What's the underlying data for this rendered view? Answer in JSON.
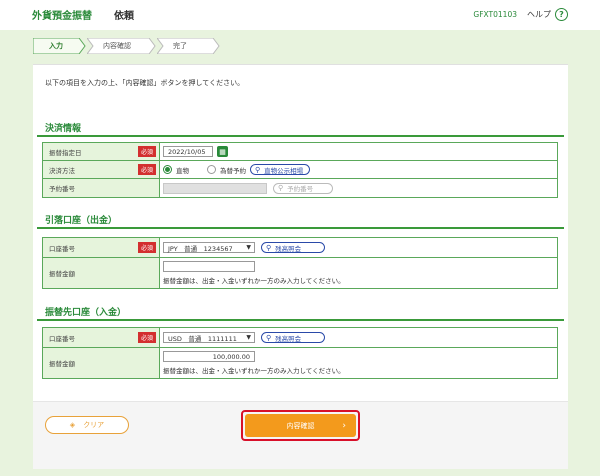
{
  "header": {
    "title": "外貨預金振替",
    "subtitle": "依頼",
    "code": "GFXT01103",
    "help_label": "ヘルプ",
    "help_icon": "?"
  },
  "steps": [
    "入力",
    "内容確認",
    "完了"
  ],
  "intro": "以下の項目を入力の上、「内容確認」ボタンを押してください。",
  "required_label": "必須",
  "settlement": {
    "title": "決済情報",
    "transfer_date_label": "振替指定日",
    "transfer_date_value": "2022/10/05",
    "method_label": "決済方法",
    "method_options": [
      "直物",
      "為替予約"
    ],
    "rate_button": "直物公示相場",
    "reservation_label": "予約番号",
    "reservation_button": "予約番号"
  },
  "withdrawal": {
    "title": "引落口座（出金）",
    "account_label": "口座番号",
    "account_value": "JPY　普通　1234567",
    "balance_button": "残高照会",
    "amount_label": "振替金額",
    "amount_value": "",
    "amount_note": "振替金額は、出金・入金いずれか一方のみ入力してください。"
  },
  "deposit": {
    "title": "振替先口座（入金）",
    "account_label": "口座番号",
    "account_value": "USD　普通　1111111",
    "balance_button": "残高照会",
    "amount_label": "振替金額",
    "amount_value": "100,000.00",
    "amount_note": "振替金額は、出金・入金いずれか一方のみ入力してください。"
  },
  "footer": {
    "clear_label": "クリア",
    "confirm_label": "内容確認"
  },
  "colors": {
    "accent": "#2a8a3a",
    "required": "#d32f2f",
    "confirm": "#f39a1c",
    "highlight": "#d8102a"
  }
}
